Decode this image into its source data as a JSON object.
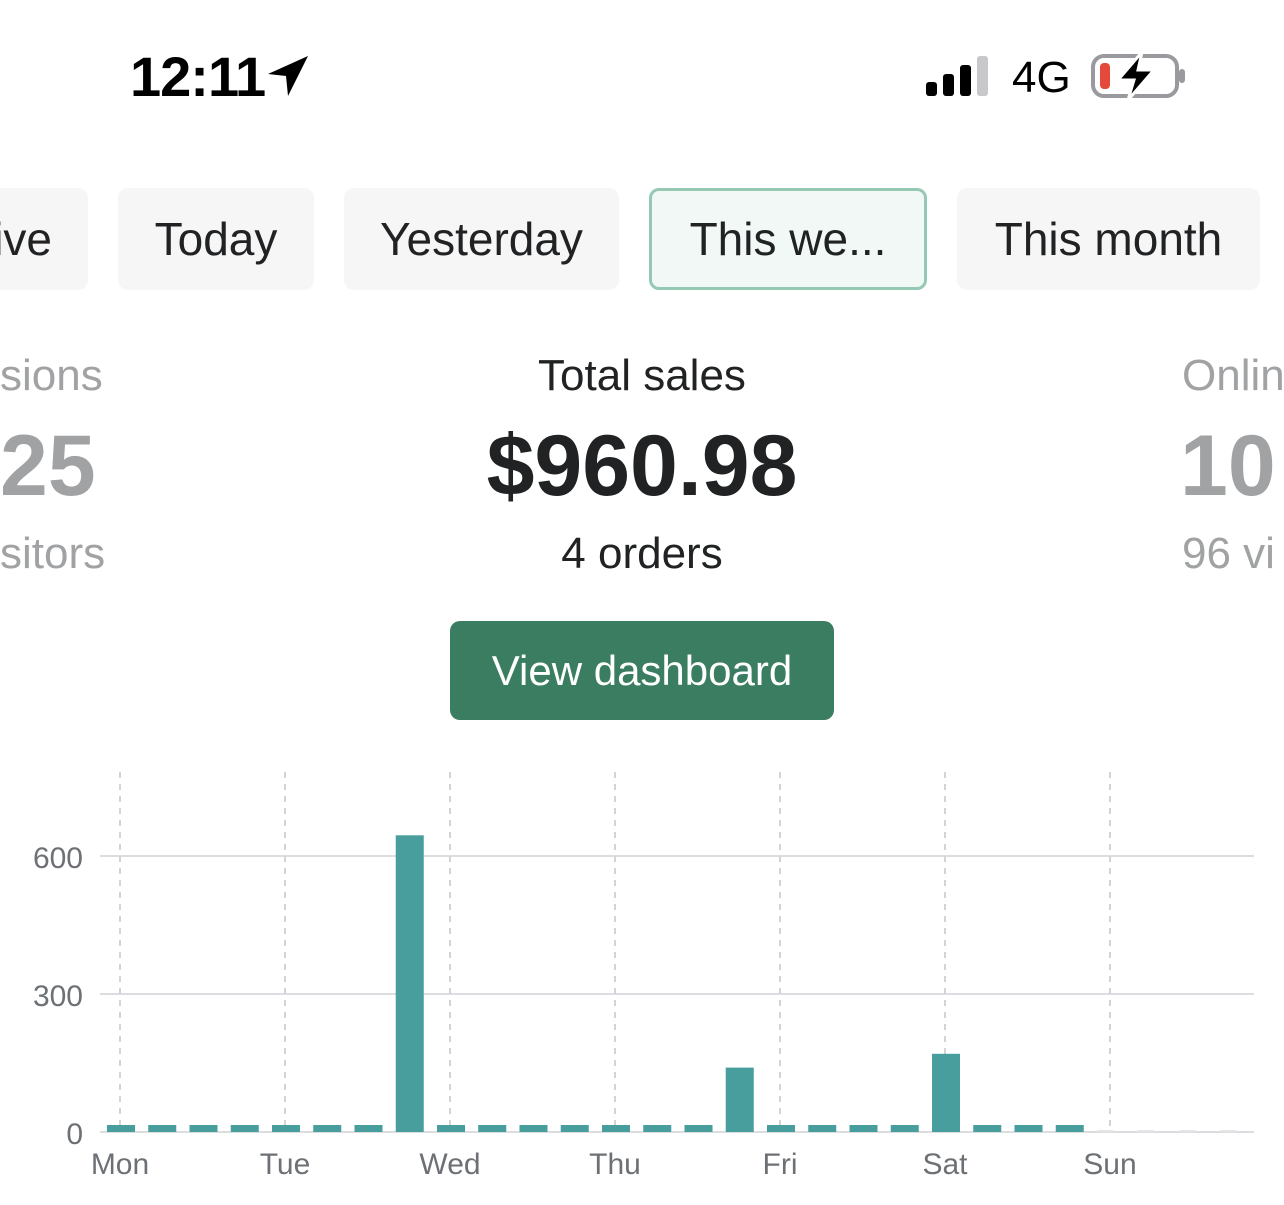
{
  "status_bar": {
    "time": "12:11",
    "network": "4G"
  },
  "filters": [
    {
      "label": "ive",
      "active": false
    },
    {
      "label": "Today",
      "active": false
    },
    {
      "label": "Yesterday",
      "active": false
    },
    {
      "label": "This we...",
      "active": true
    },
    {
      "label": "This month",
      "active": false
    }
  ],
  "metrics": {
    "left": {
      "label": "sions",
      "value": "25",
      "sub": "sitors"
    },
    "center": {
      "label": "Total sales",
      "value": "$960.98",
      "sub": "4 orders"
    },
    "right": {
      "label": "Onlin",
      "value": "10",
      "sub": "96 vi"
    }
  },
  "dashboard_button": "View dashboard",
  "colors": {
    "accent": "#3a7d61",
    "bar": "#479e9c",
    "chip_active_border": "#95c9b4"
  },
  "chart_data": {
    "type": "bar",
    "categories": [
      "Mon",
      "Tue",
      "Wed",
      "Thu",
      "Fri",
      "Sat",
      "Sun"
    ],
    "yticks": [
      "0",
      "300",
      "600"
    ],
    "ylim": [
      0,
      600
    ],
    "bars_per_day": 4,
    "values": [
      0,
      0,
      0,
      0,
      0,
      0,
      0,
      645,
      0,
      0,
      0,
      0,
      0,
      0,
      0,
      140,
      0,
      0,
      0,
      0,
      170,
      0,
      0,
      0,
      null,
      null,
      null,
      null
    ],
    "grid": true
  }
}
